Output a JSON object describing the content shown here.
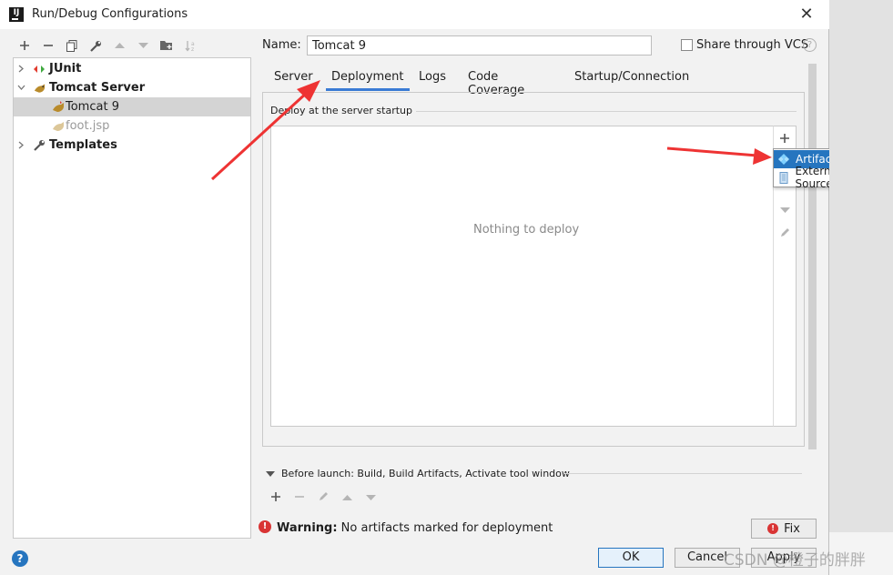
{
  "window": {
    "title": "Run/Debug Configurations",
    "app_icon_text": "IJ"
  },
  "toolbar": {
    "icons": [
      "add-icon",
      "remove-icon",
      "copy-icon",
      "wrench-icon",
      "move-up-icon",
      "move-down-icon",
      "folder-icon",
      "sort-icon"
    ]
  },
  "tree": {
    "items": [
      {
        "label": "JUnit",
        "icon": "junit-icon"
      },
      {
        "label": "Tomcat Server",
        "icon": "tomcat-icon"
      },
      {
        "label": "Tomcat 9",
        "icon": "tomcat-icon"
      },
      {
        "label": "foot.jsp",
        "icon": "tomcat-icon"
      },
      {
        "label": "Templates",
        "icon": "wrench-icon"
      }
    ]
  },
  "config": {
    "name_label": "Name:",
    "name_value": "Tomcat 9",
    "share_label": "Share through VCS",
    "share_checked": false,
    "help_glyph": "?"
  },
  "tabs": [
    {
      "label": "Server"
    },
    {
      "label": "Deployment",
      "active": true
    },
    {
      "label": "Logs"
    },
    {
      "label": "Code Coverage"
    },
    {
      "label": "Startup/Connection"
    }
  ],
  "deployment": {
    "section_label": "Deploy at the server startup",
    "empty_text": "Nothing to deploy",
    "popup_items": [
      {
        "label": "Artifact...",
        "icon": "artifact-icon"
      },
      {
        "label": "External Source...",
        "icon": "external-source-icon"
      }
    ]
  },
  "before_launch": {
    "label": "Before launch: Build, Build Artifacts, Activate tool window"
  },
  "warning": {
    "prefix": "Warning:",
    "message": "No artifacts marked for deployment"
  },
  "buttons": {
    "fix": "Fix",
    "ok": "OK",
    "cancel": "Cancel",
    "apply": "Apply",
    "help": "?"
  },
  "watermark": "CSDN @橙子的胖胖",
  "colors": {
    "accent": "#2675bf",
    "annotation_arrow": "#ee3333",
    "error": "#d93434",
    "tab_underline": "#3a7bd5"
  }
}
